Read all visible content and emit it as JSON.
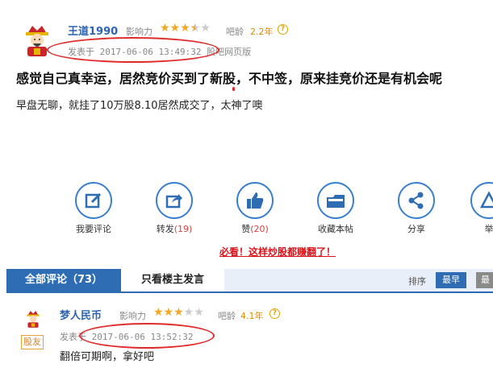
{
  "post": {
    "username": "王道1990",
    "influence_label": "影响力",
    "stars": 3.5,
    "age_label": "吧龄",
    "age_value": "2.2年",
    "meta": "发表于 2017-06-06 13:49:32 股吧网页版",
    "title": "感觉自己真幸运，居然竞价买到了新股，不中签，原来挂竞价还是有机会呢",
    "body": "早盘无聊，就挂了10万股8.10居然成交了，太神了噢"
  },
  "actions": [
    {
      "label": "我要评论",
      "count": "",
      "icon": "edit-icon"
    },
    {
      "label": "转发",
      "count": "(19)",
      "icon": "share-forward-icon"
    },
    {
      "label": "赞",
      "count": "(20)",
      "icon": "thumbs-up-icon"
    },
    {
      "label": "收藏本帖",
      "count": "",
      "icon": "bookmark-icon"
    },
    {
      "label": "分享",
      "count": "",
      "icon": "share-icon"
    },
    {
      "label": "举",
      "count": "",
      "icon": "report-icon"
    }
  ],
  "promo": "必看！这样炒股都赚翻了！",
  "tabs": {
    "all": "全部评论（73）",
    "host_only": "只看楼主发言",
    "sort_label": "排序",
    "sort_earliest": "最早",
    "sort_latest": "最"
  },
  "reply": {
    "username": "梦人民币",
    "influence_label": "影响力",
    "stars": 3,
    "age_label": "吧龄",
    "age_value": "4.1年",
    "badge": "股友",
    "meta": "发表于 2017-06-06 13:52:32",
    "text": "翻倍可期啊，拿好吧"
  },
  "colors": {
    "link_blue": "#2d64b3",
    "accent_blue": "#2e6db4",
    "star": "#f5a623",
    "annotation_red": "#e02b2b"
  }
}
